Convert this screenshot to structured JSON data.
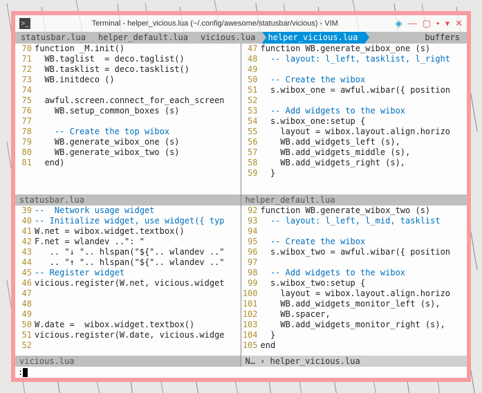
{
  "window": {
    "title": "Terminal - helper_vicious.lua (~/.config/awesome/statusbar/vicious) - VIM"
  },
  "tabs": {
    "items": [
      {
        "label": "statusbar.lua",
        "active": false
      },
      {
        "label": "helper_default.lua",
        "active": false
      },
      {
        "label": "vicious.lua",
        "active": false
      },
      {
        "label": "helper_vicious.lua",
        "active": true
      }
    ],
    "right_label": "buffers"
  },
  "panes": {
    "top_left": {
      "status": "statusbar.lua",
      "lines": [
        {
          "n": 70,
          "t": "function _M.init()",
          "cls": ""
        },
        {
          "n": 71,
          "t": "  WB.taglist  = deco.taglist()",
          "cls": ""
        },
        {
          "n": 72,
          "t": "  WB.tasklist = deco.tasklist()",
          "cls": ""
        },
        {
          "n": 73,
          "t": "  WB.initdeco ()",
          "cls": ""
        },
        {
          "n": 74,
          "t": "",
          "cls": ""
        },
        {
          "n": 75,
          "t": "  awful.screen.connect_for_each_screen",
          "cls": ""
        },
        {
          "n": 76,
          "t": "    WB.setup_common_boxes (s)",
          "cls": ""
        },
        {
          "n": 77,
          "t": "",
          "cls": ""
        },
        {
          "n": 78,
          "t": "    -- Create the top wibox",
          "cls": "cm"
        },
        {
          "n": 79,
          "t": "    WB.generate_wibox_one (s)",
          "cls": ""
        },
        {
          "n": 80,
          "t": "    WB.generate_wibox_two (s)",
          "cls": ""
        },
        {
          "n": 81,
          "t": "  end)",
          "cls": ""
        }
      ]
    },
    "top_right": {
      "status": "helper_default.lua",
      "lines": [
        {
          "n": 47,
          "t": "function WB.generate_wibox_one (s)",
          "cls": ""
        },
        {
          "n": 48,
          "t": "  -- layout: l_left, tasklist, l_right",
          "cls": "cm"
        },
        {
          "n": 49,
          "t": "",
          "cls": ""
        },
        {
          "n": 50,
          "t": "  -- Create the wibox",
          "cls": "cm"
        },
        {
          "n": 51,
          "t": "  s.wibox_one = awful.wibar({ position",
          "cls": ""
        },
        {
          "n": 52,
          "t": "",
          "cls": ""
        },
        {
          "n": 53,
          "t": "  -- Add widgets to the wibox",
          "cls": "cm"
        },
        {
          "n": 54,
          "t": "  s.wibox_one:setup {",
          "cls": ""
        },
        {
          "n": 55,
          "t": "    layout = wibox.layout.align.horizo",
          "cls": ""
        },
        {
          "n": 56,
          "t": "    WB.add_widgets_left (s),",
          "cls": ""
        },
        {
          "n": 57,
          "t": "    WB.add_widgets_middle (s),",
          "cls": ""
        },
        {
          "n": 58,
          "t": "    WB.add_widgets_right (s),",
          "cls": ""
        },
        {
          "n": 59,
          "t": "  }",
          "cls": ""
        }
      ]
    },
    "bottom_left": {
      "status": "vicious.lua",
      "lines": [
        {
          "n": 39,
          "t": "--  Network usage widget",
          "cls": "cm"
        },
        {
          "n": 40,
          "t": "-- Initialize widget, use widget({ typ",
          "cls": "cm"
        },
        {
          "n": 41,
          "t": "W.net = wibox.widget.textbox()",
          "cls": ""
        },
        {
          "n": 42,
          "t": "F.net = wlandev ..\": \"",
          "cls": ""
        },
        {
          "n": 43,
          "t": "   .. \"↓ \".. hlspan(\"${\".. wlandev ..\"",
          "cls": ""
        },
        {
          "n": 44,
          "t": "   .. \"↑ \".. hlspan(\"${\".. wlandev ..\"",
          "cls": ""
        },
        {
          "n": 45,
          "t": "-- Register widget",
          "cls": "cm"
        },
        {
          "n": 46,
          "t": "vicious.register(W.net, vicious.widget",
          "cls": ""
        },
        {
          "n": 47,
          "t": "",
          "cls": ""
        },
        {
          "n": 48,
          "t": "",
          "cls": ""
        },
        {
          "n": 49,
          "t": "",
          "cls": ""
        },
        {
          "n": 50,
          "t": "W.date =  wibox.widget.textbox()",
          "cls": ""
        },
        {
          "n": 51,
          "t": "vicious.register(W.date, vicious.widge",
          "cls": ""
        },
        {
          "n": 52,
          "t": "",
          "cls": ""
        }
      ]
    },
    "bottom_right": {
      "status": "N…  ›  helper_vicious.lua",
      "lines": [
        {
          "n": 92,
          "t": "function WB.generate_wibox_two (s)",
          "cls": ""
        },
        {
          "n": 93,
          "t": "  -- layout: l_left, l_mid, tasklist",
          "cls": "cm"
        },
        {
          "n": 94,
          "t": "",
          "cls": ""
        },
        {
          "n": 95,
          "t": "  -- Create the wibox",
          "cls": "cm"
        },
        {
          "n": 96,
          "t": "  s.wibox_two = awful.wibar({ position",
          "cls": ""
        },
        {
          "n": 97,
          "t": "",
          "cls": ""
        },
        {
          "n": 98,
          "t": "  -- Add widgets to the wibox",
          "cls": "cm"
        },
        {
          "n": 99,
          "t": "  s.wibox_two:setup {",
          "cls": ""
        },
        {
          "n": 100,
          "t": "    layout = wibox.layout.align.horizo",
          "cls": ""
        },
        {
          "n": 101,
          "t": "    WB.add_widgets_monitor_left (s),",
          "cls": ""
        },
        {
          "n": 102,
          "t": "    WB.spacer,",
          "cls": ""
        },
        {
          "n": 103,
          "t": "    WB.add_widgets_monitor_right (s),",
          "cls": ""
        },
        {
          "n": 104,
          "t": "  }",
          "cls": ""
        },
        {
          "n": 105,
          "t": "end",
          "cls": ""
        }
      ]
    }
  },
  "cmdline": {
    "prompt": ":"
  }
}
